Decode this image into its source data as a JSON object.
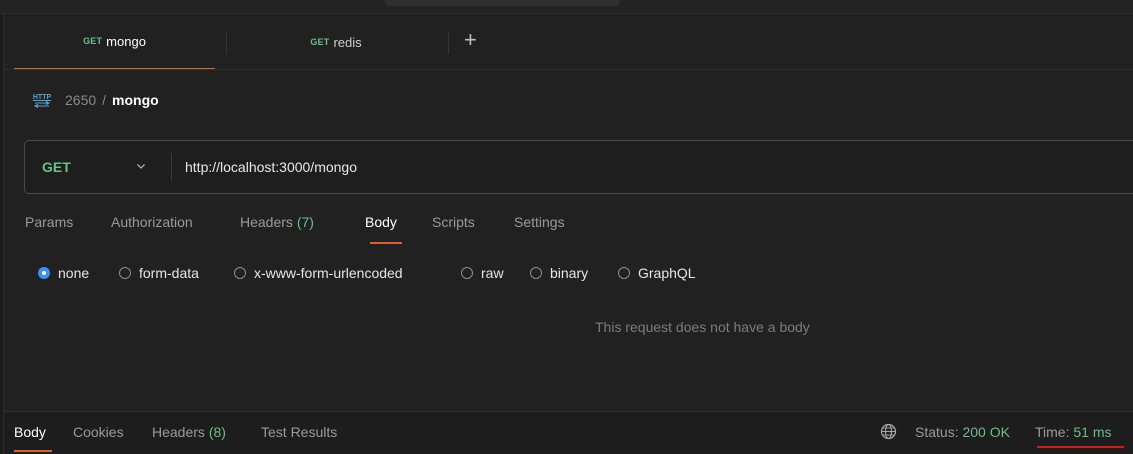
{
  "tabs": [
    {
      "method": "GET",
      "name": "mongo"
    },
    {
      "method": "GET",
      "name": "redis"
    }
  ],
  "new_tab_symbol": "+",
  "breadcrumb": {
    "parent": "2650",
    "separator": "/",
    "current": "mongo"
  },
  "request": {
    "method": "GET",
    "url": "http://localhost:3000/mongo"
  },
  "request_tabs": {
    "params": "Params",
    "authorization": "Authorization",
    "headers_label": "Headers",
    "headers_count": "(7)",
    "body": "Body",
    "scripts": "Scripts",
    "settings": "Settings"
  },
  "body_types": {
    "selected": "none",
    "options": [
      "none",
      "form-data",
      "x-www-form-urlencoded",
      "raw",
      "binary",
      "GraphQL"
    ]
  },
  "empty_body_message": "This request does not have a body",
  "response": {
    "tabs": {
      "body": "Body",
      "cookies": "Cookies",
      "headers_label": "Headers",
      "headers_count": "(8)",
      "test_results": "Test Results"
    },
    "status_label": "Status:",
    "status_value": "200 OK",
    "time_label": "Time:",
    "time_value": "51 ms"
  },
  "colors": {
    "method_green": "#6bbd8b",
    "accent_orange": "#d9622b",
    "radio_blue": "#3a8ff0",
    "highlight_red": "#d01c1c"
  },
  "icons": [
    "http-icon",
    "chevron-down-icon",
    "globe-icon",
    "plus-icon"
  ]
}
